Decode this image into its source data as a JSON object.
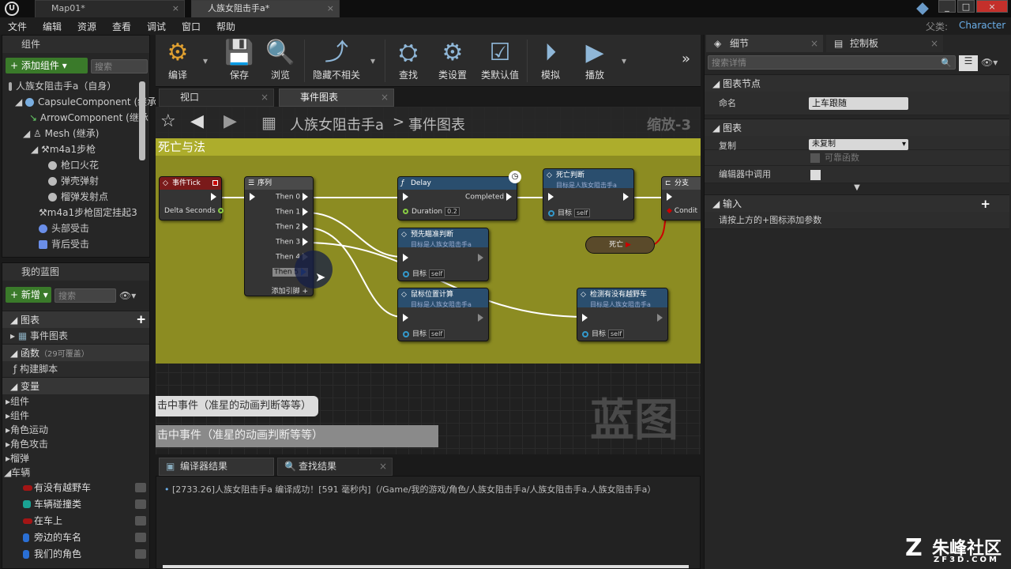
{
  "titlebar": {
    "tabs": [
      "Map01*",
      "人族女阻击手a*"
    ],
    "window_buttons": [
      "_",
      "□",
      "×"
    ]
  },
  "menubar": {
    "items": [
      "文件",
      "编辑",
      "资源",
      "查看",
      "调试",
      "窗口",
      "帮助"
    ],
    "parent_label": "父类:",
    "parent_value": "Character"
  },
  "components": {
    "title": "组件",
    "add_button": "添加组件",
    "search_placeholder": "搜索",
    "tree": [
      "人族女阻击手a（自身）",
      "CapsuleComponent (继承",
      "ArrowComponent (继承",
      "Mesh (继承)",
      "m4a1步枪",
      "枪口火花",
      "弹壳弹射",
      "榴弹发射点",
      "m4a1步枪固定挂起3",
      "头部受击",
      "背后受击"
    ]
  },
  "my_blueprint": {
    "title": "我的蓝图",
    "new_button": "新增",
    "search_placeholder": "搜索",
    "graphs_label": "图表",
    "event_graph": "事件图表",
    "functions_label": "函数",
    "functions_note": "（29可覆盖）",
    "construction_script": "构建脚本",
    "variables_label": "变量",
    "categories": [
      "组件",
      "组件",
      "角色运动",
      "角色攻击",
      "榴弹",
      "车辆"
    ],
    "vars": [
      {
        "name": "有没有越野车",
        "color": "#a31515"
      },
      {
        "name": "车辆碰撞类",
        "color": "#1aa394"
      },
      {
        "name": "在车上",
        "color": "#a31515"
      },
      {
        "name": "旁边的车名",
        "color": "#2a6fd4"
      },
      {
        "name": "我们的角色",
        "color": "#2a6fd4"
      }
    ]
  },
  "toolbar": {
    "buttons": [
      "编译",
      "保存",
      "浏览",
      "隐藏不相关",
      "查找",
      "类设置",
      "类默认值",
      "模拟",
      "播放"
    ]
  },
  "editor_tabs": [
    "视口",
    "事件图表"
  ],
  "graph": {
    "breadcrumb_bp": "人族女阻击手a",
    "breadcrumb_sep": ">",
    "breadcrumb_graph": "事件图表",
    "zoom": "缩放-3",
    "comment": "死亡与法",
    "nodes": {
      "tick": {
        "title": "事件Tick",
        "pin": "Delta Seconds"
      },
      "sequence": {
        "title": "序列",
        "pins": [
          "Then 0",
          "Then 1",
          "Then 2",
          "Then 3",
          "Then 4",
          "Then 5"
        ],
        "add_pin": "添加引脚"
      },
      "delay": {
        "title": "Delay",
        "out": "Completed",
        "duration_label": "Duration",
        "duration_value": "0.2"
      },
      "death_check": {
        "title": "死亡判断",
        "subtitle": "目标是人族女阻击手a",
        "target": "目标",
        "self": "self"
      },
      "branch": {
        "title": "分支",
        "cond": "Condit"
      },
      "death_var": {
        "label": "死亡"
      },
      "aim_check": {
        "title": "预先瞄准判断",
        "subtitle": "目标是人族女阻击手a",
        "target": "目标",
        "self": "self"
      },
      "mouse_calc": {
        "title": "鼠标位置计算",
        "subtitle": "目标是人族女阻击手a",
        "target": "目标",
        "self": "self"
      },
      "offroad_check": {
        "title": "检测有没有越野车",
        "subtitle": "目标是人族女阻击手a",
        "target": "目标",
        "self": "self"
      }
    },
    "comment_box_1": "击中事件（准星的动画判断等等）",
    "comment_box_2": "击中事件（准星的动画判断等等）",
    "watermark": "蓝图"
  },
  "bottom": {
    "tabs": [
      "编译器结果",
      "查找结果"
    ],
    "log_line": "[2733.26]人族女阻击手a 编译成功！[591 毫秒内]（/Game/我的游戏/角色/人族女阻击手a/人族女阻击手a.人族女阻击手a）"
  },
  "details": {
    "tabs": [
      "细节",
      "控制板"
    ],
    "search_placeholder": "搜索详情",
    "graph_node_section": "图表节点",
    "name_label": "命名",
    "name_value": "上车跟随",
    "graph_section": "图表",
    "replicate_label": "复制",
    "replicate_value": "未复制",
    "reliable_label": "可靠函数",
    "call_in_editor_label": "编辑器中调用",
    "inputs_section": "输入",
    "inputs_hint": "请按上方的+图标添加参数"
  },
  "brand": {
    "watermark_name": "朱峰社区",
    "watermark_url": "ZF3D.COM"
  }
}
